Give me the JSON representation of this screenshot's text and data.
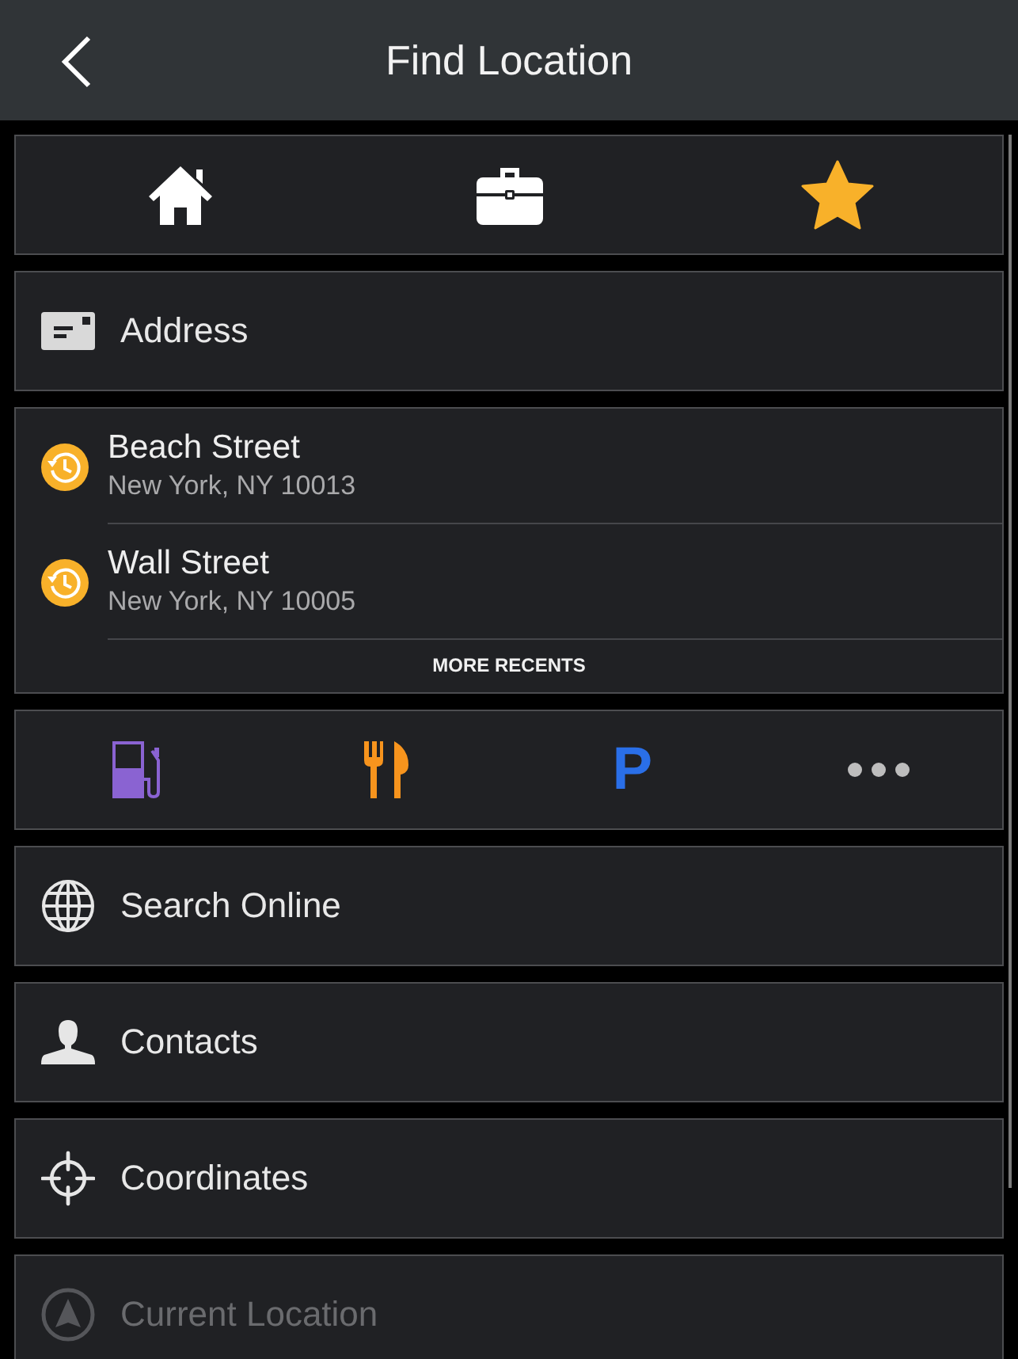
{
  "header": {
    "title": "Find Location"
  },
  "quick_places": [
    {
      "kind": "home"
    },
    {
      "kind": "work"
    },
    {
      "kind": "favorites"
    }
  ],
  "address": {
    "label": "Address"
  },
  "recents": {
    "items": [
      {
        "name": "Beach Street",
        "address": "New York, NY 10013"
      },
      {
        "name": "Wall Street",
        "address": "New York, NY 10005"
      }
    ],
    "more": "MORE RECENTS"
  },
  "categories": [
    {
      "kind": "fuel"
    },
    {
      "kind": "food"
    },
    {
      "kind": "parking",
      "glyph": "P"
    },
    {
      "kind": "more"
    }
  ],
  "menu": [
    {
      "kind": "search_online",
      "label": "Search Online",
      "disabled": false
    },
    {
      "kind": "contacts",
      "label": "Contacts",
      "disabled": false
    },
    {
      "kind": "coordinates",
      "label": "Coordinates",
      "disabled": false
    },
    {
      "kind": "current_location",
      "label": "Current Location",
      "disabled": true
    }
  ]
}
